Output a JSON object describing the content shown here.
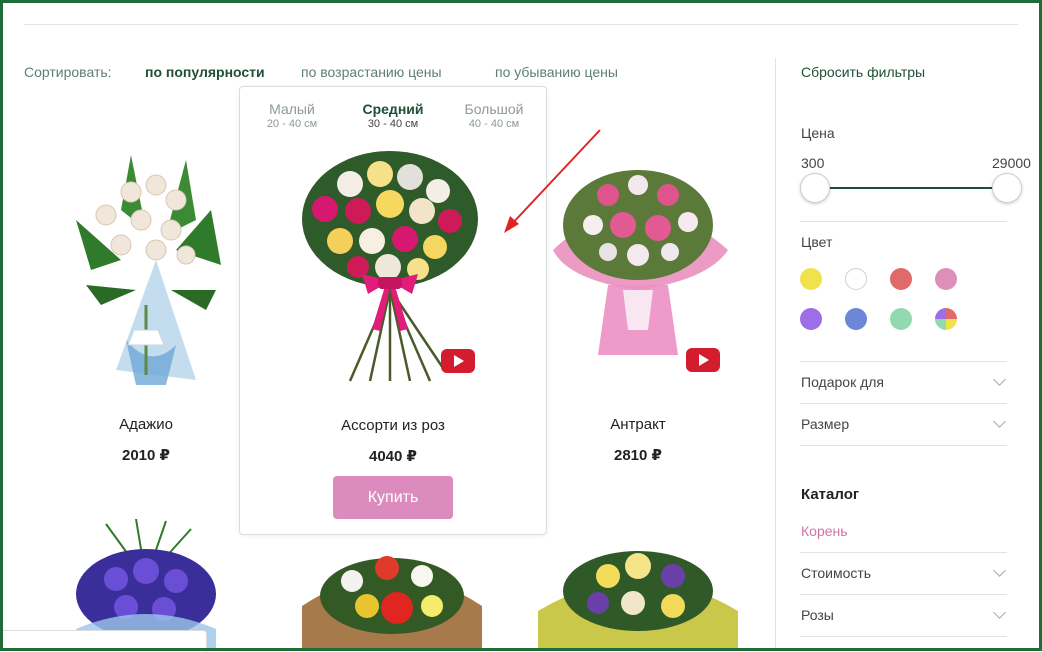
{
  "sort": {
    "label": "Сортировать:",
    "options": [
      "по популярности",
      "по возрастанию цены",
      "по убыванию цены"
    ],
    "active": "по популярности"
  },
  "sizes": [
    {
      "name": "Малый",
      "dims": "20 - 40 см"
    },
    {
      "name": "Средний",
      "dims": "30 - 40 см"
    },
    {
      "name": "Большой",
      "dims": "40 - 40 см"
    }
  ],
  "products": [
    {
      "name": "Адажио",
      "price": "2010 ₽"
    },
    {
      "name": "Ассорти из роз",
      "price": "4040 ₽",
      "buy_label": "Купить"
    },
    {
      "name": "Антракт",
      "price": "2810 ₽"
    }
  ],
  "sidebar": {
    "reset": "Сбросить фильтры",
    "price": {
      "label": "Цена",
      "min": "300",
      "max": "29000"
    },
    "color_label": "Цвет",
    "colors": [
      "#f0e24a",
      "#ffffff",
      "#e06a6a",
      "#dd8fba",
      "#9d6ee6",
      "#6d86d6",
      "#93d9af",
      "multicolor"
    ],
    "filters": [
      "Подарок для",
      "Размер"
    ],
    "catalog": {
      "title": "Каталог",
      "active": "Корень",
      "items": [
        "Стоимость",
        "Розы"
      ]
    }
  },
  "colors": {
    "accent": "#1f4f35",
    "buy": "#db8bbd",
    "video": "#d31c2e"
  }
}
